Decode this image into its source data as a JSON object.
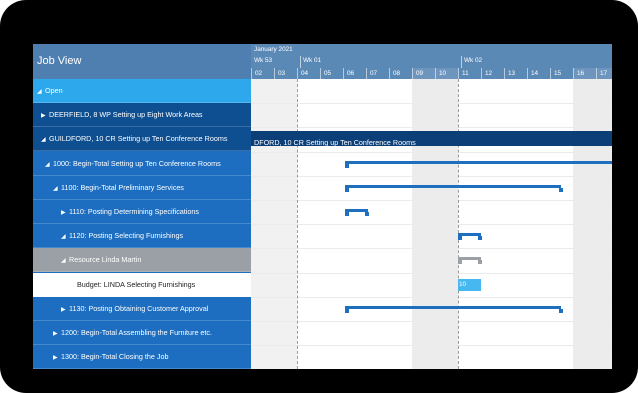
{
  "tree": {
    "header": "Job View",
    "rows": [
      {
        "label": "Open",
        "level": "group",
        "tri": "◢"
      },
      {
        "label": "DEERFIELD, 8 WP Setting up Eight Work Areas",
        "level": "lvl0",
        "tri": "▶"
      },
      {
        "label": "GUILDFORD, 10 CR Setting up Ten Conference Rooms",
        "level": "lvl0",
        "tri": "◢"
      },
      {
        "label": "1000: Begin-Total Setting up Ten Conference Rooms",
        "level": "lvl1",
        "tri": "◢"
      },
      {
        "label": "1100: Begin-Total Preliminary Services",
        "level": "lvl1",
        "tri": "◢"
      },
      {
        "label": "1110: Posting Determining Specifications",
        "level": "lvl1",
        "tri": "▶"
      },
      {
        "label": "1120: Posting Selecting Furnishings",
        "level": "lvl1",
        "tri": "◢"
      },
      {
        "label": "Resource Linda Martin",
        "level": "res",
        "tri": "◢"
      },
      {
        "label": "Budget: LINDA Selecting Furnishings",
        "level": "budget",
        "tri": ""
      },
      {
        "label": "1130: Posting Obtaining Customer Approval",
        "level": "lvl1",
        "tri": "▶"
      },
      {
        "label": "1200: Begin-Total Assembling the Furniture etc.",
        "level": "lvl1",
        "tri": "▶"
      },
      {
        "label": "1300: Begin-Total Closing the Job",
        "level": "lvl1",
        "tri": "▶"
      }
    ]
  },
  "gantt": {
    "month": "January 2021",
    "weeks": [
      "Wk 53",
      "Wk 01",
      "Wk 02"
    ],
    "days": [
      "02",
      "03",
      "04",
      "05",
      "06",
      "07",
      "08",
      "09",
      "10",
      "11",
      "12",
      "13",
      "14",
      "15",
      "16",
      "17"
    ],
    "weekend_days": [
      "09",
      "10",
      "16",
      "17"
    ],
    "band_text": "DFORD, 10 CR Setting up Ten Conference Rooms",
    "budget_value": "10"
  },
  "colors": {
    "header": "#5b89b6",
    "tree_bg": "#1f6fc0",
    "group": "#2da8ec",
    "job_row": "#0e4f91",
    "resource": "#9aa0a6",
    "budget_bar": "#47b7f0",
    "task_bar": "#1f6fc0"
  }
}
